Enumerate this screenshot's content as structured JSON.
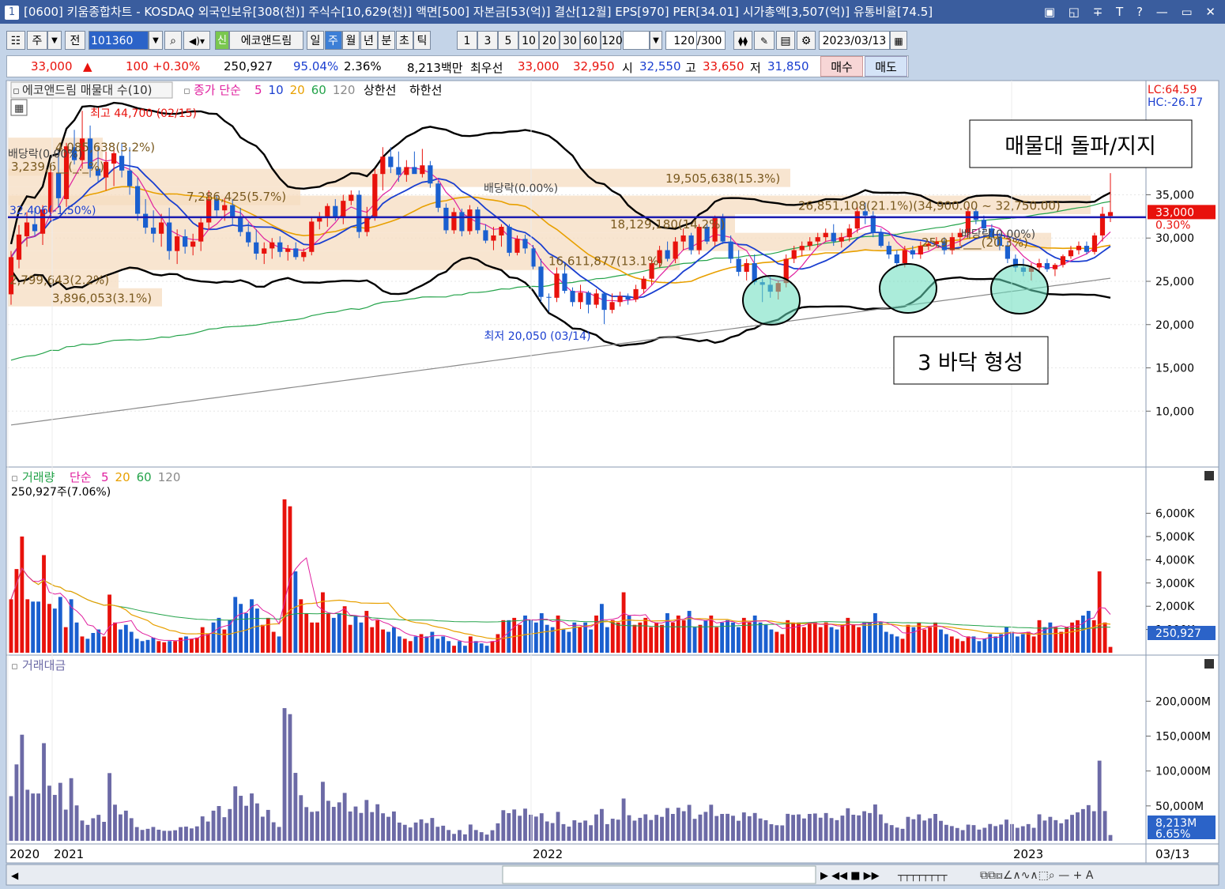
{
  "titlebar": {
    "index": "1",
    "text": "[0600] 키움종합차트 - KOSDAQ 외국인보유[308(천)] 주식수[10,629(천)] 액면[500] 자본금[53(억)] 결산[12월] EPS[970] PER[34.01] 시가총액[3,507(억)] 유통비율[74.5]",
    "controls": "▣ ◱ ∓ T ? — ▭ ✕"
  },
  "toolbar": {
    "period_type": "주",
    "prev": "전",
    "code": "101360",
    "new_badge": "신",
    "name": "에코앤드림",
    "periods": [
      "일",
      "주",
      "월",
      "년",
      "분",
      "초",
      "틱"
    ],
    "selected_period": "주",
    "intervals": [
      "1",
      "3",
      "5",
      "10",
      "20",
      "30",
      "60",
      "120"
    ],
    "count": "120",
    "count_total": "/300",
    "date": "2023/03/13"
  },
  "quote": {
    "price": "33,000",
    "arrow": "▲",
    "change": "100",
    "change_pct": "+0.30%",
    "volume": "250,927",
    "ratio1": "95.04%",
    "ratio2": "2.36%",
    "amount": "8,213백만",
    "best_label": "최우선",
    "ask": "33,000",
    "bid": "32,950",
    "open_label": "시",
    "open": "32,550",
    "high_label": "고",
    "high": "33,650",
    "low_label": "저",
    "low": "31,850",
    "buy": "매수",
    "sell": "매도"
  },
  "colors": {
    "up": "#e8120c",
    "down": "#1a5fcf",
    "ma5": "#e0209f",
    "ma10": "#1a3fd0",
    "ma20": "#e8a000",
    "ma60": "#24a34a",
    "ma120": "#8a8a8a",
    "band": "#000000",
    "zone": "#f5dcc0",
    "support_line": "#1b1bb0",
    "highlight": "#66ddbb"
  },
  "chart_data": [
    {
      "type": "candlestick",
      "title": "에코앤드림 매물대 수(10)",
      "indicators_label": "종가 단순",
      "ma_periods": [
        "5",
        "10",
        "20",
        "60",
        "120"
      ],
      "extra_lines": [
        "상한선",
        "하한선"
      ],
      "y_ticks": [
        10000,
        15000,
        20000,
        25000,
        30000,
        35000
      ],
      "y_tick_labels": [
        "10,000",
        "15,000",
        "20,000",
        "25,000",
        "30,000",
        "35,000"
      ],
      "ylim": [
        4000,
        46000
      ],
      "x_tick_labels": [
        "2020",
        "2021",
        "2022",
        "2023",
        "03/13"
      ],
      "corner_labels": {
        "lc": "LC:64.59",
        "hc": "HC:-26.17"
      },
      "current_price_label": "33,000",
      "current_pct_label": "0.30%",
      "current_price": 33000,
      "support_line_value": 32406,
      "support_line_label": "32,406(-1.50%)",
      "high_marker": "최고 44,700 (02/15)",
      "low_marker": "최저 20,050 (03/14)",
      "dividend_labels": [
        "배당락(0.00%)",
        "배당락(0.00%)",
        "배당락(0.00%)"
      ],
      "volume_profile": [
        {
          "label": "4,085,638(3.2%)",
          "low": 39500,
          "high": 41600
        },
        {
          "label": "3,239,6__(_._%)",
          "low": 37200,
          "high": 39500
        },
        {
          "label": "19,505,638(15.3%)",
          "low": 35900,
          "high": 38000
        },
        {
          "label": "7,286,425(5.7%)",
          "low": 33800,
          "high": 35900
        },
        {
          "label": "26,851,108(21.1%)(34,900.00 ~ 32,750.00)",
          "low": 32750,
          "high": 34900
        },
        {
          "label": "18,129,180(14.2%)",
          "low": 30600,
          "high": 32750
        },
        {
          "label": "25,9__,___(20.3%)",
          "low": 28500,
          "high": 30600
        },
        {
          "label": "16,611,877(13.1%)",
          "low": 26300,
          "high": 28500
        },
        {
          "label": "2,799,643(2.2%)",
          "low": 24200,
          "high": 26300
        },
        {
          "label": "3,896,053(3.1%)",
          "low": 22100,
          "high": 24200
        }
      ],
      "annotations": [
        "매물대 돌파/지지",
        "3 바닥 형성"
      ],
      "candles": [
        [
          23500,
          28500,
          22300,
          27800
        ],
        [
          27500,
          31500,
          26500,
          30400
        ],
        [
          30200,
          33000,
          29000,
          31800
        ],
        [
          31600,
          33500,
          30300,
          30800
        ],
        [
          30500,
          33800,
          29200,
          33300
        ],
        [
          33000,
          38500,
          32000,
          37600
        ],
        [
          37500,
          40000,
          33500,
          34600
        ],
        [
          34500,
          41000,
          33600,
          40600
        ],
        [
          40500,
          42500,
          38500,
          39000
        ],
        [
          39000,
          44700,
          38000,
          41500
        ],
        [
          41500,
          43000,
          37000,
          38000
        ],
        [
          38000,
          40500,
          36500,
          37200
        ],
        [
          37000,
          40000,
          35500,
          38800
        ],
        [
          38600,
          40500,
          36000,
          39800
        ],
        [
          39500,
          41000,
          37000,
          37800
        ],
        [
          37800,
          40500,
          35000,
          36000
        ],
        [
          36000,
          37000,
          32000,
          32800
        ],
        [
          32800,
          34500,
          30500,
          31200
        ],
        [
          31200,
          33200,
          29500,
          30500
        ],
        [
          30500,
          32800,
          29000,
          31800
        ],
        [
          31800,
          33500,
          27500,
          28500
        ],
        [
          28500,
          31000,
          27000,
          30200
        ],
        [
          30200,
          31000,
          28200,
          29000
        ],
        [
          29000,
          30500,
          28000,
          29600
        ],
        [
          29600,
          32500,
          28500,
          31800
        ],
        [
          31800,
          35500,
          31000,
          34500
        ],
        [
          34500,
          35000,
          32500,
          33200
        ],
        [
          33200,
          34600,
          32000,
          33800
        ],
        [
          33800,
          34500,
          31500,
          32500
        ],
        [
          32500,
          33500,
          30200,
          30700
        ],
        [
          30700,
          31800,
          29000,
          29500
        ],
        [
          29500,
          31000,
          27500,
          28200
        ],
        [
          28200,
          29500,
          27000,
          28800
        ],
        [
          28800,
          30000,
          27600,
          29500
        ],
        [
          29500,
          30200,
          27800,
          28400
        ],
        [
          28400,
          29200,
          27400,
          28800
        ],
        [
          28800,
          29500,
          27500,
          27800
        ],
        [
          27800,
          28800,
          27300,
          28400
        ],
        [
          28400,
          32500,
          28000,
          31900
        ],
        [
          31900,
          33000,
          31000,
          32500
        ],
        [
          32500,
          34000,
          31300,
          33700
        ],
        [
          33700,
          34500,
          32000,
          32400
        ],
        [
          32400,
          35000,
          31600,
          34300
        ],
        [
          34300,
          35500,
          33800,
          35000
        ],
        [
          35000,
          35500,
          30000,
          30700
        ],
        [
          30700,
          33600,
          30200,
          32500
        ],
        [
          32500,
          38000,
          32000,
          37400
        ],
        [
          37400,
          40500,
          35500,
          39400
        ],
        [
          39400,
          40500,
          37500,
          38200
        ],
        [
          38200,
          40000,
          36500,
          37300
        ],
        [
          37300,
          39000,
          36500,
          38200
        ],
        [
          38200,
          40000,
          37500,
          37400
        ],
        [
          37400,
          40300,
          37000,
          38400
        ],
        [
          38400,
          38900,
          35800,
          36300
        ],
        [
          36300,
          36600,
          33000,
          33500
        ],
        [
          33500,
          34000,
          30500,
          30900
        ],
        [
          30900,
          33500,
          30500,
          33000
        ],
        [
          33000,
          33400,
          30200,
          30800
        ],
        [
          30800,
          33800,
          30400,
          33300
        ],
        [
          33300,
          33600,
          30500,
          30900
        ],
        [
          30900,
          31600,
          29400,
          29700
        ],
        [
          29700,
          31300,
          28600,
          30300
        ],
        [
          30300,
          31600,
          29000,
          31300
        ],
        [
          31300,
          31600,
          27900,
          28300
        ],
        [
          28300,
          30300,
          28000,
          29900
        ],
        [
          29900,
          30400,
          28200,
          28800
        ],
        [
          28800,
          29200,
          26400,
          26700
        ],
        [
          26700,
          27600,
          22600,
          23200
        ],
        [
          23200,
          23600,
          21500,
          23100
        ],
        [
          23100,
          26600,
          22600,
          25900
        ],
        [
          25900,
          27100,
          23600,
          23900
        ],
        [
          23900,
          24300,
          22100,
          22600
        ],
        [
          22600,
          24600,
          21800,
          23700
        ],
        [
          23700,
          23900,
          21300,
          22300
        ],
        [
          22300,
          24100,
          21900,
          23600
        ],
        [
          23600,
          23800,
          20050,
          21700
        ],
        [
          21700,
          23600,
          21300,
          22600
        ],
        [
          22600,
          23800,
          22100,
          23300
        ],
        [
          23300,
          23600,
          22300,
          22900
        ],
        [
          22900,
          24600,
          22600,
          24100
        ],
        [
          24100,
          25600,
          23600,
          25300
        ],
        [
          25300,
          27600,
          24600,
          27100
        ],
        [
          27100,
          29100,
          26600,
          28600
        ],
        [
          28600,
          29600,
          27300,
          27600
        ],
        [
          27600,
          30100,
          27100,
          29600
        ],
        [
          29600,
          31100,
          28600,
          30300
        ],
        [
          30300,
          30600,
          28100,
          28600
        ],
        [
          28600,
          31600,
          28100,
          31300
        ],
        [
          31300,
          31600,
          29300,
          29600
        ],
        [
          29600,
          32600,
          29100,
          32300
        ],
        [
          32300,
          32800,
          29300,
          29600
        ],
        [
          29600,
          30300,
          27100,
          27600
        ],
        [
          27600,
          28600,
          25600,
          26100
        ],
        [
          26100,
          27600,
          25100,
          27100
        ],
        [
          27100,
          28100,
          24600,
          24900
        ],
        [
          24900,
          25300,
          22600,
          24600
        ],
        [
          24600,
          25600,
          23100,
          23800
        ],
        [
          23800,
          25100,
          22900,
          24800
        ],
        [
          24800,
          28100,
          24300,
          27600
        ],
        [
          27600,
          29100,
          27100,
          28600
        ],
        [
          28600,
          29600,
          27900,
          29100
        ],
        [
          29100,
          30100,
          28600,
          29600
        ],
        [
          29600,
          30600,
          28900,
          30100
        ],
        [
          30100,
          31100,
          29600,
          30600
        ],
        [
          30600,
          31600,
          29100,
          29600
        ],
        [
          29600,
          30600,
          28900,
          30100
        ],
        [
          30100,
          31600,
          29600,
          31100
        ],
        [
          31100,
          33600,
          30600,
          33100
        ],
        [
          33100,
          34100,
          31600,
          32600
        ],
        [
          32600,
          33100,
          30100,
          30600
        ],
        [
          30600,
          31100,
          28900,
          29100
        ],
        [
          29100,
          29600,
          27600,
          28100
        ],
        [
          28100,
          28600,
          26600,
          27100
        ],
        [
          27100,
          29100,
          26600,
          28600
        ],
        [
          28600,
          29100,
          27600,
          28100
        ],
        [
          28100,
          29600,
          27600,
          29100
        ],
        [
          29100,
          29600,
          28600,
          29300
        ],
        [
          29300,
          30100,
          28900,
          29600
        ],
        [
          29600,
          30100,
          28100,
          28600
        ],
        [
          28600,
          30600,
          28100,
          30100
        ],
        [
          30100,
          31100,
          29100,
          30600
        ],
        [
          30600,
          33600,
          30100,
          33100
        ],
        [
          33100,
          33600,
          31600,
          32100
        ],
        [
          32100,
          32600,
          30600,
          31100
        ],
        [
          31100,
          31600,
          29600,
          30100
        ],
        [
          30100,
          30600,
          28600,
          29100
        ],
        [
          29100,
          29600,
          27100,
          27600
        ],
        [
          27600,
          28100,
          26100,
          26600
        ],
        [
          26600,
          27600,
          25600,
          26100
        ],
        [
          26100,
          27100,
          25100,
          26600
        ],
        [
          26600,
          27600,
          26100,
          27100
        ],
        [
          27100,
          27600,
          26100,
          26400
        ],
        [
          26400,
          27100,
          25600,
          26900
        ],
        [
          26900,
          28100,
          26600,
          27900
        ],
        [
          27900,
          29100,
          27600,
          28600
        ],
        [
          28600,
          29600,
          28100,
          29100
        ],
        [
          29100,
          29600,
          28100,
          28400
        ],
        [
          28400,
          30600,
          28100,
          30300
        ],
        [
          30300,
          33600,
          29600,
          32800
        ],
        [
          32550,
          37500,
          31850,
          33000
        ]
      ]
    },
    {
      "type": "bar",
      "title": "거래량",
      "indicators_label": "단순",
      "ma_periods": [
        "5",
        "20",
        "60",
        "120"
      ],
      "subtitle": "250,927주(7.06%)",
      "y_ticks": [
        1000,
        2000,
        3000,
        4000,
        5000,
        6000
      ],
      "y_tick_labels": [
        "1,000K",
        "2,000K",
        "3,000K",
        "4,000K",
        "5,000K",
        "6,000K"
      ],
      "ylim": [
        0,
        6800
      ],
      "current_value_label": "250,927",
      "current_pct_label": "7.06%",
      "unit": "K주",
      "values": [
        2300,
        3600,
        5000,
        2300,
        2200,
        2200,
        4200,
        2100,
        1900,
        2400,
        1100,
        2300,
        1300,
        700,
        600,
        850,
        1000,
        700,
        2500,
        1300,
        1000,
        1200,
        900,
        600,
        500,
        550,
        650,
        500,
        450,
        500,
        500,
        650,
        700,
        600,
        650,
        1100,
        800,
        1300,
        1500,
        1000,
        1400,
        2400,
        2100,
        1700,
        2300,
        1900,
        1200,
        1500,
        900,
        700,
        6600,
        6300,
        3500,
        2300,
        1700,
        1300,
        1300,
        2600,
        1700,
        1500,
        1700,
        2000,
        1200,
        1600,
        1300,
        1800,
        1100,
        1400,
        1000,
        900,
        1100,
        700,
        600,
        500,
        700,
        800,
        700,
        900,
        600,
        700,
        500,
        300,
        500,
        300,
        700,
        500,
        400,
        300,
        500,
        800,
        1400,
        1400,
        1500,
        1200,
        1600,
        1400,
        1300,
        1700,
        1200,
        1100,
        1600,
        1000,
        900,
        1300,
        1100,
        1300,
        1000,
        1600,
        2100,
        1100,
        1400,
        1300,
        2600,
        1600,
        1200,
        1300,
        1500,
        1100,
        1300,
        1200,
        1700,
        1300,
        1600,
        1400,
        1800,
        1100,
        1200,
        1400,
        1600,
        1100,
        1300,
        1400,
        1300,
        1100,
        1500,
        1300,
        1600,
        1300,
        1200,
        1000,
        900,
        800,
        1400,
        1300,
        1300,
        1100,
        1300,
        1300,
        1100,
        1300,
        1100,
        1000,
        1200,
        1500,
        1200,
        1100,
        1300,
        1300,
        1700,
        1300,
        900,
        800,
        700,
        600,
        1200,
        1100,
        1300,
        1000,
        1100,
        1300,
        1000,
        800,
        700,
        600,
        500,
        700,
        700,
        500,
        600,
        800,
        700,
        800,
        1100,
        900,
        700,
        800,
        900,
        700,
        1400,
        1100,
        1300,
        1100,
        900,
        1100,
        1300,
        1400,
        1600,
        1800,
        1400,
        3500,
        1300,
        251
      ],
      "up": []
    },
    {
      "type": "bar",
      "title": "거래대금",
      "y_ticks": [
        50000,
        100000,
        150000,
        200000
      ],
      "y_tick_labels": [
        "50,000M",
        "100,000M",
        "150,000M",
        "200,000M"
      ],
      "ylim": [
        0,
        240000
      ],
      "current_value_label": "8,213M",
      "current_pct_label": "6.65%",
      "unit": "백만",
      "values": []
    }
  ]
}
